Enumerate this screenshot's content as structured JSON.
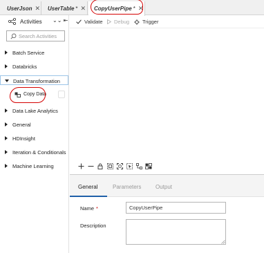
{
  "tabs": [
    {
      "label": "UserJson",
      "modified": false,
      "close": "✕",
      "icon": "table-icon"
    },
    {
      "label": "UserTable",
      "modified": true,
      "star": "*",
      "close": "✕",
      "icon": "table-icon"
    },
    {
      "label": "CopyUserPipe",
      "modified": true,
      "star": "*",
      "close": "✕",
      "icon": "pipeline-icon",
      "active": true
    }
  ],
  "sidebar": {
    "title": "Activities",
    "collapse_glyph": "⌄⌄ ⇤",
    "search_placeholder": "Search Activities",
    "categories": [
      {
        "label": "Batch Service",
        "expanded": false
      },
      {
        "label": "Databricks",
        "expanded": false
      },
      {
        "label": "Data Transformation",
        "expanded": true,
        "selected": true
      },
      {
        "label": "Data Lake Analytics",
        "expanded": false
      },
      {
        "label": "General",
        "expanded": false
      },
      {
        "label": "HDInsight",
        "expanded": false
      },
      {
        "label": "Iteration & Conditionals",
        "expanded": false
      },
      {
        "label": "Machine Learning",
        "expanded": false
      }
    ],
    "activity_item": {
      "label": "Copy Data",
      "icon": "copy-data-icon"
    }
  },
  "toolbar": {
    "validate": "Validate",
    "debug": "Debug",
    "trigger": "Trigger"
  },
  "properties": {
    "tabs": [
      {
        "label": "General",
        "active": true
      },
      {
        "label": "Parameters",
        "active": false
      },
      {
        "label": "Output",
        "active": false
      }
    ],
    "name_label": "Name",
    "required_mark": "*",
    "name_value": "CopyUserPipe",
    "description_label": "Description",
    "description_value": ""
  },
  "colors": {
    "annotation": "#d40000",
    "accent": "#1f5fa8",
    "selection_border": "#9cc4e8"
  }
}
